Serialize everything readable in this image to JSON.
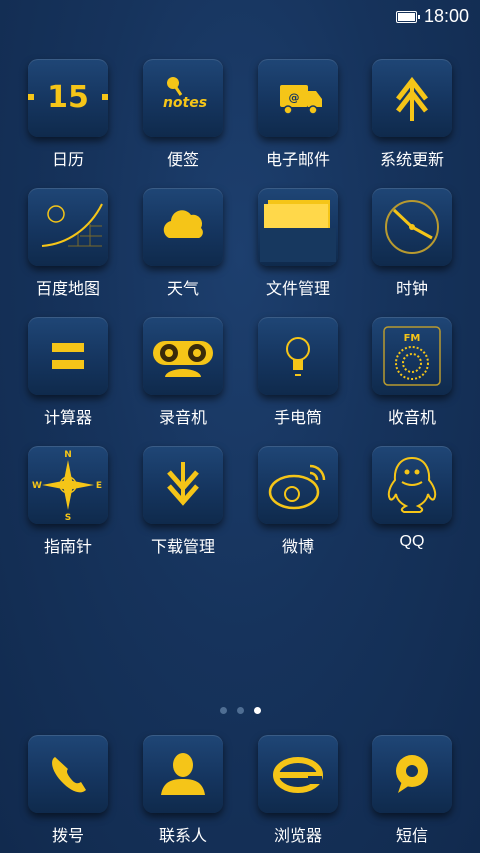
{
  "status_bar": {
    "time": "18:00",
    "battery_icon": "battery-icon"
  },
  "apps": [
    {
      "label": "日历",
      "icon": "calendar-icon",
      "badge": "15"
    },
    {
      "label": "便签",
      "icon": "notes-icon",
      "badge": "notes"
    },
    {
      "label": "电子邮件",
      "icon": "mail-icon"
    },
    {
      "label": "系统更新",
      "icon": "system-update-icon"
    },
    {
      "label": "百度地图",
      "icon": "map-icon"
    },
    {
      "label": "天气",
      "icon": "weather-icon"
    },
    {
      "label": "文件管理",
      "icon": "folder-icon"
    },
    {
      "label": "时钟",
      "icon": "clock-icon"
    },
    {
      "label": "计算器",
      "icon": "calculator-icon"
    },
    {
      "label": "录音机",
      "icon": "recorder-icon"
    },
    {
      "label": "手电筒",
      "icon": "flashlight-icon"
    },
    {
      "label": "收音机",
      "icon": "radio-icon",
      "badge": "FM"
    },
    {
      "label": "指南针",
      "icon": "compass-icon",
      "directions": [
        "N",
        "S",
        "W",
        "E"
      ]
    },
    {
      "label": "下载管理",
      "icon": "download-icon"
    },
    {
      "label": "微博",
      "icon": "weibo-icon"
    },
    {
      "label": "QQ",
      "icon": "qq-icon"
    }
  ],
  "page_indicator": {
    "count": 3,
    "active": 3
  },
  "dock": [
    {
      "label": "拨号",
      "icon": "phone-icon"
    },
    {
      "label": "联系人",
      "icon": "contacts-icon"
    },
    {
      "label": "浏览器",
      "icon": "browser-icon"
    },
    {
      "label": "短信",
      "icon": "messages-icon"
    }
  ],
  "colors": {
    "accent": "#f5c518",
    "background": "#16335c",
    "tile": "#15355f"
  }
}
